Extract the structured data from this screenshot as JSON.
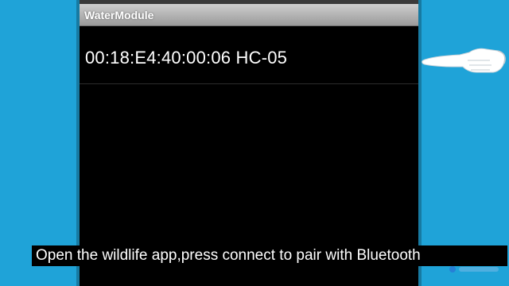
{
  "app": {
    "title": "WaterModule"
  },
  "device_list": [
    {
      "label": "00:18:E4:40:00:06 HC-05"
    }
  ],
  "caption": {
    "text": "Open the wildlife app,press connect to pair with Bluetooth"
  },
  "icons": {
    "pointer": "pointing-hand-icon"
  },
  "colors": {
    "background": "#1FA3D8",
    "screen": "#000000",
    "titlebar": "#B5B5B5",
    "text": "#FFFFFF"
  }
}
